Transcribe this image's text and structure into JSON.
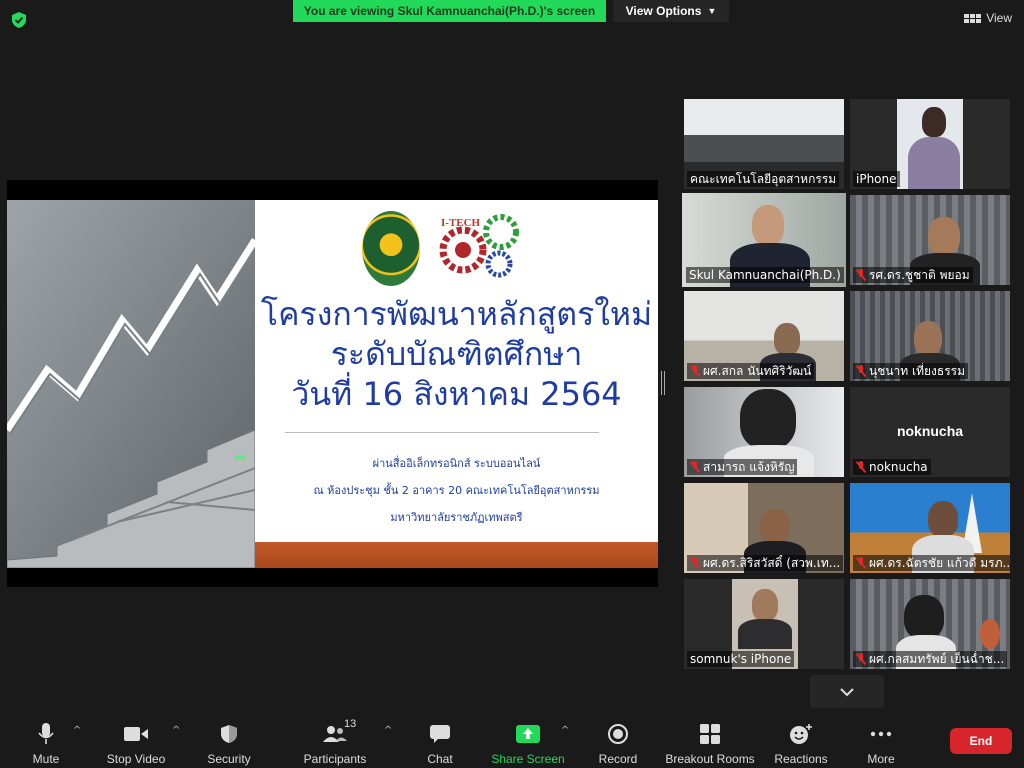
{
  "banner": {
    "text": "You are viewing Skul Kamnuanchai(Ph.D.)'s screen"
  },
  "view_options": {
    "label": "View Options"
  },
  "view_button": {
    "label": "View"
  },
  "slide": {
    "title_lines": [
      "โครงการพัฒนาหลักสูตรใหม่",
      "ระดับบัณฑิตศึกษา",
      "วันที่ 16 สิงหาคม 2564"
    ],
    "sub_lines": [
      "ผ่านสื่ออิเล็กทรอนิกส์ ระบบออนไลน์",
      "ณ ห้องประชุม ชั้น 2 อาคาร 20 คณะเทคโนโลยีอุตสาหกรรม",
      "มหาวิทยาลัยราชภัฏเทพสตรี"
    ],
    "logo_text": "I-TECH"
  },
  "participants": [
    {
      "name": "คณะเทคโนโลยีอุตสาหกรรม",
      "muted": false,
      "active": false,
      "scene": "office"
    },
    {
      "name": "iPhone",
      "muted": false,
      "active": false,
      "scene": "poster"
    },
    {
      "name": "Skul Kamnuanchai(Ph.D.)",
      "muted": false,
      "active": true,
      "scene": "man"
    },
    {
      "name": "รศ.ดร.ชูชาติ  พยอม",
      "muted": true,
      "active": false,
      "scene": "curtain"
    },
    {
      "name": "ผศ.สกล  นันทศิริวัฒน์",
      "muted": true,
      "active": false,
      "scene": "room"
    },
    {
      "name": "นุชนาท  เที่ยงธรรม",
      "muted": true,
      "active": false,
      "scene": "curtain"
    },
    {
      "name": "สามารถ  แจ้งหิรัญ",
      "muted": true,
      "active": false,
      "scene": "office2"
    },
    {
      "name": "noknucha",
      "muted": true,
      "active": false,
      "scene": "blank"
    },
    {
      "name": "ผศ.ดร.สิริสวัสดิ์ (สวพ.เท...",
      "muted": true,
      "active": false,
      "scene": "books"
    },
    {
      "name": "ผศ.ดร.ฉัตรชัย แก้วดี มรภ...",
      "muted": true,
      "active": false,
      "scene": "temple"
    },
    {
      "name": "somnuk's iPhone",
      "muted": false,
      "active": false,
      "scene": "dark"
    },
    {
      "name": "ผศ.กลสมทรัพย์  เย็นฉ่ำช...",
      "muted": true,
      "active": false,
      "scene": "woman"
    }
  ],
  "toolbar": {
    "mute": "Mute",
    "stop_video": "Stop Video",
    "security": "Security",
    "participants": "Participants",
    "participants_count": "13",
    "chat": "Chat",
    "share_screen": "Share Screen",
    "record": "Record",
    "breakout": "Breakout Rooms",
    "reactions": "Reactions",
    "more": "More",
    "end": "End"
  },
  "colors": {
    "share_green": "#23d959",
    "end_red": "#d7262b",
    "active_yellow": "#f0e76e"
  }
}
